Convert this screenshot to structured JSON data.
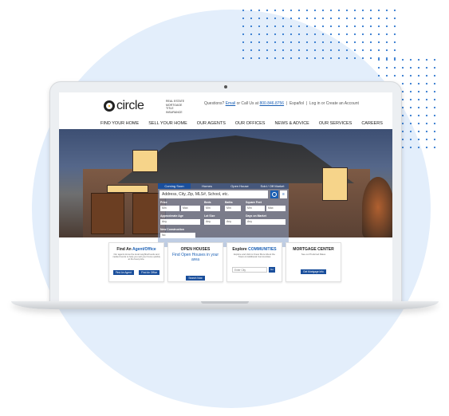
{
  "logo": {
    "name": "circle",
    "tagline": [
      "REAL ESTATE",
      "MORTGAGE",
      "TITLE",
      "INSURANCE"
    ]
  },
  "header": {
    "question": "Questions?",
    "email": "Email",
    "or_call": "or Call Us at",
    "phone": "800.846.8756",
    "espanol": "Español",
    "login": "Log in or Create an Account"
  },
  "nav": [
    "FIND YOUR HOME",
    "SELL YOUR HOME",
    "OUR AGENTS",
    "OUR OFFICES",
    "NEWS & ADVICE",
    "OUR SERVICES",
    "CAREERS"
  ],
  "search": {
    "tabs": [
      "Coming Soon",
      "Homes",
      "Open House",
      "Sold / Off Market"
    ],
    "placeholder": "Address, City, Zip, MLS#, School, etc.",
    "labels": {
      "price": "Price",
      "beds": "Beds",
      "baths": "Baths",
      "sqft": "Square Feet",
      "age": "Approximate Age",
      "lot": "Lot Size",
      "days": "Days on Market",
      "new_builds": "New Construction"
    },
    "values": {
      "min": "Min",
      "max": "Max",
      "any": "Any",
      "no": "No"
    }
  },
  "cards": [
    {
      "title": "Find An",
      "title_accent": "Agent/Office",
      "text": "Our agents know the local neighborhoods and market trends to help you sell your home quickly at the best price.",
      "btn1": "Find An Agent",
      "btn2": "Find An Office"
    },
    {
      "title": "OPEN HOUSES",
      "sub": "Find Open Houses in your area",
      "btn1": "Search Now"
    },
    {
      "title": "Explore",
      "title_accent": "COMMUNITIES",
      "text": "Explore and click to Know More About the Towns & Additional Communities",
      "placeholder": "Enter City",
      "btn1": "Go"
    },
    {
      "title": "MORTGAGE CENTER",
      "text": "See our Preferred Rates",
      "btn1": "Get Mortgage Info"
    }
  ]
}
